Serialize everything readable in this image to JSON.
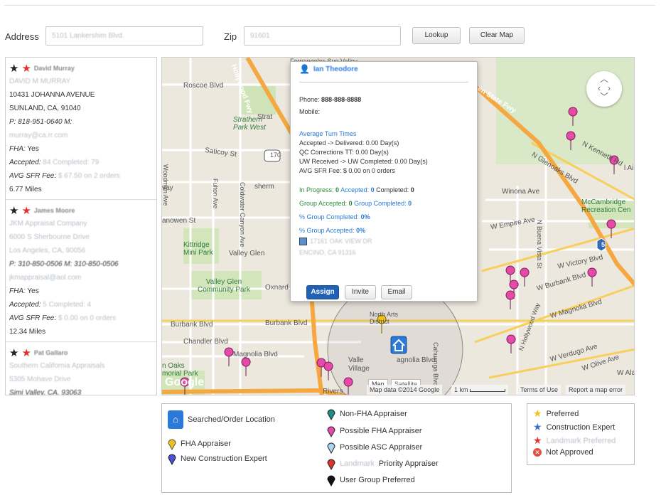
{
  "search": {
    "address_label": "Address",
    "address_value": "5101 Lankershim Blvd.",
    "zip_label": "Zip",
    "zip_value": "91601",
    "lookup_label": "Lookup",
    "clear_label": "Clear Map"
  },
  "results": [
    {
      "name": "David Murray",
      "company": "DAVID M MURRAY",
      "street": "10431 JOHANNA AVENUE",
      "city": "SUNLAND, CA, 91040",
      "phone": "P: 818-951-0640 M:",
      "email": "murray@ca.rr.com",
      "fha_label": "FHA:",
      "fha_value": "Yes",
      "accepted_label": "Accepted:",
      "accepted_value": "84 Completed: 79",
      "fee_label": "AVG SFR Fee:",
      "fee_value": "$ 67.50 on 2 orders",
      "distance": "6.77 Miles"
    },
    {
      "name": "James Moore",
      "company": "JKM Appraisal Company",
      "street": "6000 S Sherbourne Drive",
      "city": "Los Angeles, CA, 90056",
      "phone": "P: 310-850-0506 M: 310-850-0506",
      "email": "jkmappraisal@aol.com",
      "fha_label": "FHA:",
      "fha_value": "Yes",
      "accepted_label": "Accepted:",
      "accepted_value": "5 Completed: 4",
      "fee_label": "AVG SFR Fee:",
      "fee_value": "$ 0.00 on 0 orders",
      "distance": "12.34 Miles"
    },
    {
      "name": "Pat Gallaro",
      "company": "Southern California Appraisals",
      "street": "5305 Mohave Drive",
      "city": "Simi Valley, CA, 93063"
    }
  ],
  "map": {
    "labels": {
      "roscoe": "Roscoe Blvd",
      "hollywood_fwy": "Hollywood Fwy",
      "strathern": "Strathern\nPark West",
      "saticoy": "Saticoy St",
      "valley_glen": "Valley Glen",
      "kittridge": "Kittridge\nMini Park",
      "valley_glen_park": "Valley Glen\nCommunity Park",
      "burbank_blvd": "Burbank Blvd",
      "burbank_blvd2": "Burbank Blvd",
      "chandler": "Chandler Blvd",
      "magnolia": "Magnolia Blvd",
      "oaks": "n Oaks\nmorial Park",
      "noho": "North Arts\nDistrict",
      "winona": "Winona Ave",
      "mccambridge": "McCambridge\nRecreation Cen",
      "empire": "W Empire Ave",
      "victory": "W Victory Blvd",
      "w_burbank": "W Burbank Blvd",
      "w_magnolia": "W Magnolia Blvd",
      "verdugo": "W Verdugo Ave",
      "olive": "W Olive Ave",
      "glenoaks": "N Glenoaks Blvd",
      "kenneth": "N Kenneth Rd",
      "state_fwy": "en State Fwy",
      "buena_vista": "N Buena Vista St",
      "hollywood_n": "N Hollywood Way",
      "oxnard": "Oxnard",
      "fulton": "Fulton Ave",
      "coldwater": "Coldwater Canyon Ave",
      "woodman": "Woodman Ave",
      "route170": "170",
      "route5": "5",
      "alai": "l Ai",
      "ventura_fwy": "Ventura Fwy",
      "rivers": "Rivers",
      "wala": "W Ala",
      "magnolia_near": "agnolia Blvd",
      "valley": "Valle",
      "village": "Village",
      "cahuenga": "Cahuenga Blvd",
      "strat": "Strat",
      "ave_short": "vay",
      "anowen": "anowen St",
      "sherm": "sherm",
      "google": "Google",
      "top_labels": "Fernangeles   Sun Valley"
    },
    "attribution": "Map data ©2014 Google",
    "scale": "1 km",
    "terms": "Terms of Use",
    "report": "Report a map error",
    "maptype_map": "Map",
    "maptype_satellite": "Satellite",
    "user_icon": "person-icon"
  },
  "popup": {
    "name": "Ian Theodore",
    "phone_label": "Phone:",
    "phone_value": "888-888-8888",
    "mobile_label": "Mobile:",
    "turn_times_title": "Average Turn Times",
    "turn1": "Accepted -> Delivered: 0.00 Day(s)",
    "turn2": "QC Corrections TT: 0.00 Day(s)",
    "turn3": "UW Received -> UW Completed: 0.00 Day(s)",
    "turn4": "AVG SFR Fee: $ 0.00 on 0 orders",
    "in_progress_label": "In Progress:",
    "in_progress_value": "0",
    "accepted_label": "Accepted:",
    "accepted_value": "0",
    "completed_label": "Completed:",
    "completed_value": "0",
    "group_accepted_label": "Group Accepted:",
    "group_accepted_value": "0",
    "group_completed_label": "Group Completed:",
    "group_completed_value": "0",
    "pct_group_completed_label": "% Group Completed:",
    "pct_group_completed_value": "0%",
    "pct_group_accepted_label": "% Group Accepted:",
    "pct_group_accepted_value": "0%",
    "address_line1": "17161 OAK VIEW DR",
    "address_line2": "ENCINO, CA 91316",
    "assign_label": "Assign",
    "invite_label": "Invite",
    "email_label": "Email"
  },
  "legend": {
    "searched": "Searched/Order Location",
    "fha": "FHA Appraiser",
    "new_construction": "New Construction Expert",
    "non_fha": "Non-FHA Appraiser",
    "possible_fha": "Possible FHA Appraiser",
    "possible_asc": "Possible ASC Appraiser",
    "landmark_priority_blur": "Landmark",
    "landmark_priority": "Priority Appraiser",
    "user_group": "User Group Preferred"
  },
  "legend2": {
    "preferred": "Preferred",
    "construction": "Construction Expert",
    "landmark": "Landmark Preferred",
    "not_approved": "Not Approved"
  },
  "colors": {
    "fha_pin": "#f2c21b",
    "new_construction_pin": "#4a52d9",
    "non_fha_pin": "#1b8f86",
    "possible_fha_pin": "#e64aa7",
    "possible_asc_pin": "#a9d8ee",
    "landmark_pin": "#e0312a",
    "user_group_pin": "#111111",
    "searched": "#2c7ad8"
  }
}
